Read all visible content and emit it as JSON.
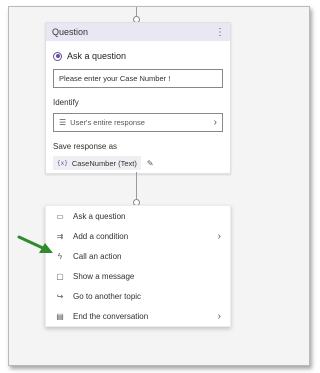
{
  "question_node": {
    "header_title": "Question",
    "more_glyph": "⋮",
    "radio_label": "Ask a question",
    "input_value": "Please enter your Case Number !",
    "identify_label": "Identify",
    "identify_value": "User's entire response",
    "save_label": "Save response as",
    "variable_name": "CaseNumber (Text)"
  },
  "add_node_menu": {
    "items": [
      {
        "label": "Ask a question",
        "icon": "chat-question-icon"
      },
      {
        "label": "Add a condition",
        "icon": "branch-icon"
      },
      {
        "label": "Call an action",
        "icon": "lightning-icon"
      },
      {
        "label": "Show a message",
        "icon": "message-icon"
      },
      {
        "label": "Go to another topic",
        "icon": "redirect-icon"
      },
      {
        "label": "End the conversation",
        "icon": "end-icon"
      }
    ]
  },
  "colors": {
    "accent": "#6b4ea3",
    "arrow": "#2e8b2e",
    "header_bg": "#e9e7f4"
  }
}
